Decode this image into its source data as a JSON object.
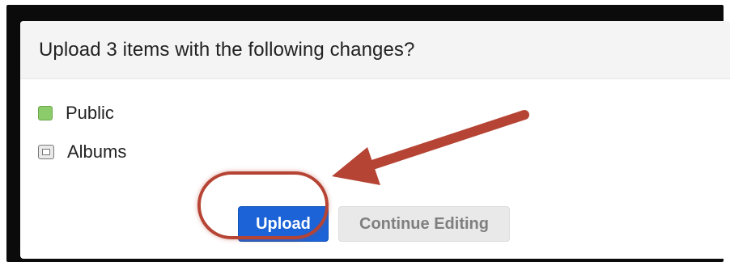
{
  "dialog": {
    "title": "Upload 3 items with the following changes?",
    "changes": [
      {
        "label": "Public",
        "icon": "public-color-swatch-icon",
        "color": "#8ccc6b"
      },
      {
        "label": "Albums",
        "icon": "albums-icon"
      }
    ],
    "buttons": {
      "upload_label": "Upload",
      "continue_label": "Continue Editing"
    }
  },
  "annotation": {
    "color": "#b64434",
    "target": "upload-button"
  }
}
